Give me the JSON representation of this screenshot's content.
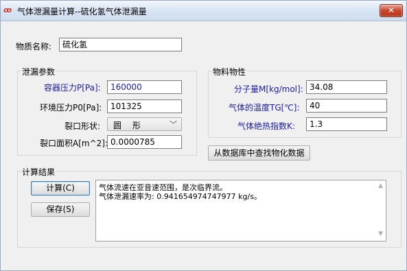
{
  "window": {
    "title": "气体泄漏量计算--硫化氢气体泄漏量",
    "app_icon_glyph": "ꝏ",
    "close_glyph": "✕"
  },
  "substance": {
    "label": "物质名称:",
    "value": "硫化氢"
  },
  "leak_params": {
    "group_title": "泄漏参数",
    "vessel_pressure": {
      "label": "容器压力P[Pa]:",
      "value": "160000"
    },
    "ambient_pressure": {
      "label": "环境压力P0[Pa]:",
      "value": "101325"
    },
    "orifice_shape": {
      "label": "裂口形状:",
      "value": "圆 形"
    },
    "orifice_area": {
      "label": "裂口面积A[m^2]:",
      "value": "0.0000785"
    }
  },
  "properties": {
    "group_title": "物料物性",
    "molecular_weight": {
      "label": "分子量M[kg/mol]:",
      "value": "34.08"
    },
    "gas_temperature": {
      "label": "气体的温度TG[℃]:",
      "value": "40"
    },
    "adiabatic_index": {
      "label": "气体绝热指数K:",
      "value": "1.3"
    },
    "lookup_button": "从数据库中查找物化数据"
  },
  "results": {
    "group_title": "计算结果",
    "calc_button": "计算(C)",
    "save_button": "保存(S)",
    "lines": [
      "气体流速在亚音速范围，是次临界流。",
      "气体泄漏速率为: 0.941654974747977 kg/s。"
    ]
  },
  "colors": {
    "label_blue": "#1a1aa6",
    "close_red": "#c9462c"
  }
}
